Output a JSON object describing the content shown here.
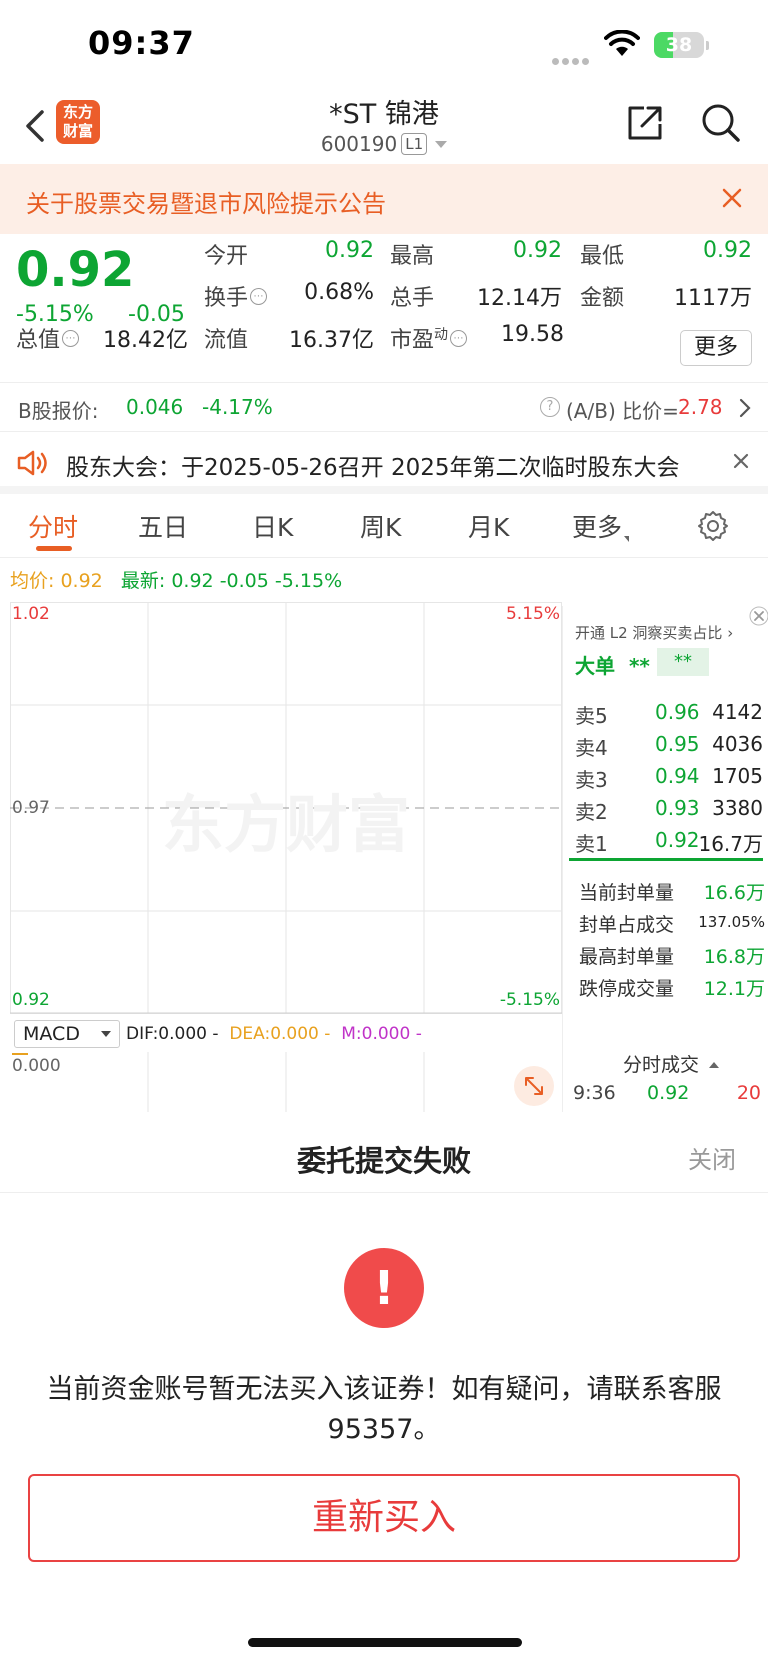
{
  "status_bar": {
    "time": "09:37",
    "battery": "38",
    "battery_level": 0.38
  },
  "nav": {
    "logo_line1": "东方",
    "logo_line2": "财富",
    "title": "*ST 锦港",
    "code": "600190",
    "level_badge": "L1"
  },
  "notice": {
    "text": "关于股票交易暨退市风险提示公告"
  },
  "quote": {
    "price": "0.92",
    "change_pct": "-5.15%",
    "change_val": "-0.05",
    "open_label": "今开",
    "open": "0.92",
    "high_label": "最高",
    "high": "0.92",
    "low_label": "最低",
    "low": "0.92",
    "turnover_label": "换手",
    "turnover": "0.68%",
    "volume_label": "总手",
    "volume": "12.14万",
    "amount_label": "金额",
    "amount": "1117万",
    "total_cap_label": "总值",
    "total_cap": "18.42亿",
    "float_cap_label": "流值",
    "float_cap": "16.37亿",
    "pe_label": "市盈",
    "pe_sup": "动",
    "pe": "19.58",
    "more_label": "更多",
    "info_mark": "⋯"
  },
  "bshare": {
    "label": "B股报价:",
    "price": "0.046",
    "pct": "-4.17%",
    "help": "?",
    "ratio_label": "(A/B) 比价=",
    "ratio": "2.78"
  },
  "meeting": {
    "text": "股东大会：于2025-05-26召开 2025年第二次临时股东大会"
  },
  "tabs": {
    "t0": "分时",
    "t1": "五日",
    "t2": "日K",
    "t3": "周K",
    "t4": "月K",
    "t5": "更多"
  },
  "avgline": {
    "avg_label": "均价:",
    "avg": "0.92",
    "last_label": "最新:",
    "last": "0.92",
    "chg": "-0.05",
    "pct": "-5.15%"
  },
  "chart": {
    "top_left": "1.02",
    "top_right": "5.15%",
    "mid": "0.97",
    "bottom_left": "0.92",
    "bottom_right": "-5.15%",
    "watermark": "东方财富"
  },
  "macd": {
    "indicator": "MACD",
    "dif": "DIF:0.000 -",
    "dea": "DEA:0.000 -",
    "m": "M:0.000 -",
    "zero": "0.000"
  },
  "side": {
    "header": "开通 L2 洞察买卖占比",
    "big_label": "大单",
    "big_val1": "**",
    "big_val2": "**",
    "asks": [
      {
        "label": "卖5",
        "price": "0.96",
        "vol": "4142"
      },
      {
        "label": "卖4",
        "price": "0.95",
        "vol": "4036"
      },
      {
        "label": "卖3",
        "price": "0.94",
        "vol": "1705"
      },
      {
        "label": "卖2",
        "price": "0.93",
        "vol": "3380"
      },
      {
        "label": "卖1",
        "price": "0.92",
        "vol": "16.7万"
      }
    ],
    "seal": [
      {
        "label": "当前封单量",
        "value": "16.6万"
      },
      {
        "label": "封单占成交",
        "value": "137.05%"
      },
      {
        "label": "最高封单量",
        "value": "16.8万"
      },
      {
        "label": "跌停成交量",
        "value": "12.1万"
      }
    ],
    "ticks_label": "分时成交",
    "tick": {
      "time": "9:36",
      "price": "0.92",
      "vol": "20"
    }
  },
  "dialog": {
    "title": "委托提交失败",
    "close": "关闭",
    "icon": "!",
    "message": "当前资金账号暂无法买入该证券！如有疑问，请联系客服95357。",
    "retry": "重新买入"
  },
  "colors": {
    "accent": "#e85e24",
    "down": "#0da533",
    "up": "#e83b3b"
  }
}
